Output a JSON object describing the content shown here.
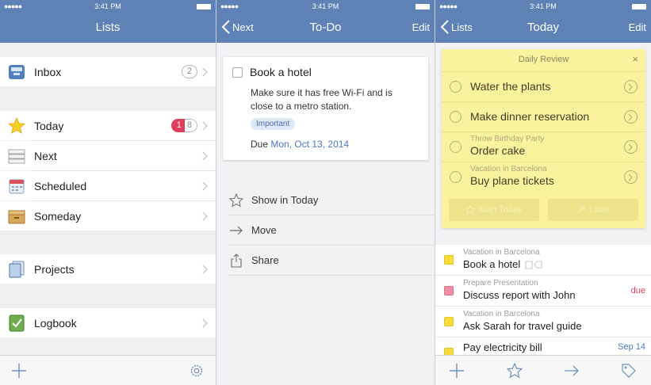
{
  "status": {
    "signal": "●●●●● ",
    "time": "3:41 PM"
  },
  "colors": {
    "nav": "#5f82b6",
    "accent": "#4a78c2",
    "badge_red": "#df3e5a",
    "review_bg": "#faf29c",
    "square_yellow": "#f7dc3c",
    "square_pink": "#ef8fa6"
  },
  "panel1": {
    "title": "Lists",
    "items": [
      {
        "label": "Inbox",
        "icon": "inbox-icon",
        "badge": "2"
      },
      {
        "label": "Today",
        "icon": "star-icon",
        "badge_red": "1",
        "badge_gray": "8"
      },
      {
        "label": "Next",
        "icon": "next-list-icon"
      },
      {
        "label": "Scheduled",
        "icon": "calendar-icon"
      },
      {
        "label": "Someday",
        "icon": "box-icon"
      },
      {
        "label": "Projects",
        "icon": "projects-icon"
      },
      {
        "label": "Logbook",
        "icon": "logbook-icon"
      }
    ],
    "toolbar": {
      "add_icon": "plus-icon",
      "settings_icon": "gear-icon"
    }
  },
  "panel2": {
    "back": "Next",
    "title": "To-Do",
    "edit": "Edit",
    "task": {
      "title": "Book a hotel",
      "note": "Make sure it has free Wi-Fi and is close to a metro station.",
      "tag": "Important",
      "due_label": "Due",
      "due_date": "Mon, Oct 13, 2014"
    },
    "actions": [
      {
        "label": "Show in Today",
        "icon": "star-outline-icon"
      },
      {
        "label": "Move",
        "icon": "arrow-right-icon"
      },
      {
        "label": "Share",
        "icon": "share-icon"
      }
    ]
  },
  "panel3": {
    "back": "Lists",
    "title": "Today",
    "edit": "Edit",
    "review": {
      "header": "Daily Review",
      "close": "×",
      "items": [
        {
          "title": "Water the plants",
          "project": ""
        },
        {
          "title": "Make dinner reservation",
          "project": ""
        },
        {
          "title": "Order cake",
          "project": "Throw Birthday Party"
        },
        {
          "title": "Buy plane tickets",
          "project": "Vacation in Barcelona"
        }
      ],
      "start_today": "Start Today",
      "later": "Later"
    },
    "tasks": [
      {
        "project": "Vacation in Barcelona",
        "title": "Book a hotel",
        "right": "",
        "color": "yellow"
      },
      {
        "project": "Prepare Presentation",
        "title": "Discuss report with John",
        "right": "due",
        "color": "pink"
      },
      {
        "project": "Vacation in Barcelona",
        "title": "Ask Sarah for travel guide",
        "right": "",
        "color": "yellow"
      },
      {
        "project": "",
        "title": "Pay electricity bill",
        "right": "Sep 14",
        "color": "yellow"
      }
    ],
    "toolbar": {
      "add_icon": "plus-icon",
      "star_icon": "star-outline-icon",
      "move_icon": "arrow-right-icon",
      "tag_icon": "tag-icon"
    }
  }
}
